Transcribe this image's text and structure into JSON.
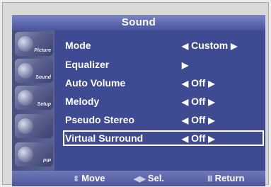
{
  "title": "Sound",
  "sidebar": {
    "items": [
      {
        "icon": "picture-icon",
        "caption": "Picture"
      },
      {
        "icon": "sound-icon",
        "caption": "Sound"
      },
      {
        "icon": "setup-icon",
        "caption": "Setup"
      },
      {
        "icon": "channel-icon",
        "caption": ""
      },
      {
        "icon": "pip-icon",
        "caption": "PIP"
      }
    ]
  },
  "menu": {
    "left_arrow": "◀",
    "right_arrow": "▶",
    "items": [
      {
        "label": "Mode",
        "value": "Custom"
      },
      {
        "label": "Equalizer",
        "value": ""
      },
      {
        "label": "Auto Volume",
        "value": "Off"
      },
      {
        "label": "Melody",
        "value": "Off"
      },
      {
        "label": "Pseudo Stereo",
        "value": "Off"
      },
      {
        "label": "Virtual Surround",
        "value": "Off"
      }
    ],
    "selected_index": 5
  },
  "footer": {
    "move_label": "Move",
    "move_icon": "⇕",
    "select_label": "Sel.",
    "select_icon": "◀▶",
    "return_label": "Return",
    "return_icon": "Ⅲ"
  },
  "colors": {
    "screen_bg": "#3e4a92",
    "title_bg": "#5d68ae",
    "text": "#ffffff"
  }
}
